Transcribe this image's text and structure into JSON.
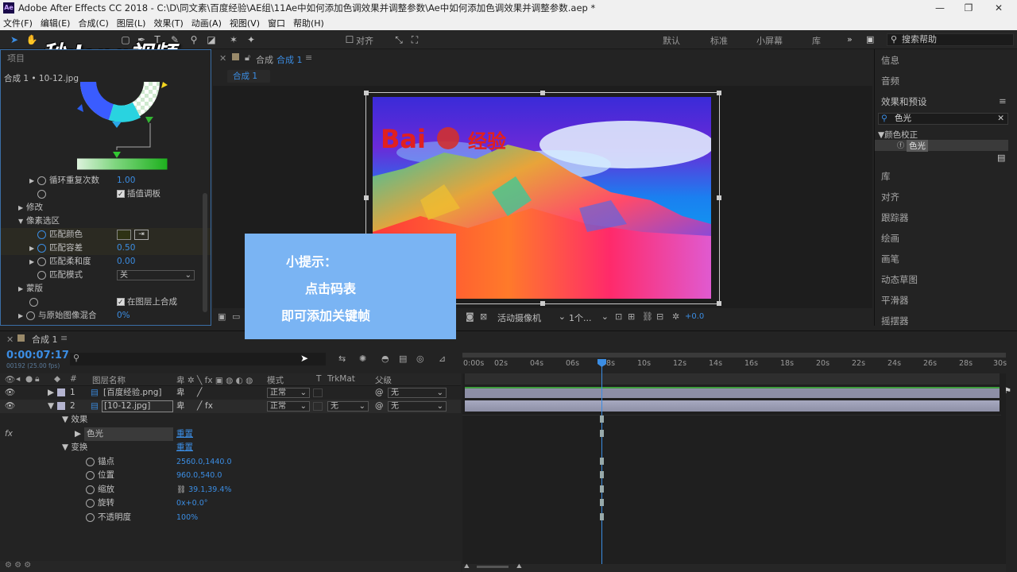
{
  "window": {
    "title": "Adobe After Effects CC 2018 - C:\\D\\同文素\\百度经验\\AE组\\11Ae中如何添加色调效果并调整参数\\Ae中如何添加色调效果并调整参数.aep *"
  },
  "menu": [
    "文件(F)",
    "编辑(E)",
    "合成(C)",
    "图层(L)",
    "效果(T)",
    "动画(A)",
    "视图(V)",
    "窗口",
    "帮助(H)"
  ],
  "toolbar": {
    "align_label": "对齐",
    "workspaces": [
      "默认",
      "标准",
      "小屏幕",
      "库"
    ],
    "search_help_placeholder": "搜索帮助"
  },
  "watermark": "秒dong视频",
  "left_panel": {
    "tab": "项目",
    "title": "合成 1 • 10-12.jpg",
    "rows": [
      {
        "label": "循环重复次数",
        "value": "1.00"
      },
      {
        "label": "插值调板"
      },
      {
        "label": "修改"
      },
      {
        "label": "像素选区"
      },
      {
        "label": "匹配颜色"
      },
      {
        "label": "匹配容差",
        "value": "0.50"
      },
      {
        "label": "匹配柔和度",
        "value": "0.00"
      },
      {
        "label": "匹配模式",
        "value": "关"
      },
      {
        "label": "蒙版"
      },
      {
        "label": "在图层上合成"
      },
      {
        "label": "与原始图像混合",
        "value": "0%"
      }
    ]
  },
  "composition": {
    "tab_label": "合成",
    "tab_name": "合成 1",
    "sub_tab": "合成 1",
    "image_logo": "Bai",
    "image_logo_suffix": "经验",
    "camera": "活动摄像机",
    "views": "1个...",
    "exposure": "+0.0"
  },
  "right_panel": {
    "items_top": [
      "信息",
      "音频",
      "效果和预设"
    ],
    "search_value": "色光",
    "tree_group": "颜色校正",
    "tree_item": "色光",
    "items_bottom": [
      "库",
      "对齐",
      "跟踪器",
      "绘画",
      "画笔",
      "动态草图",
      "平滑器",
      "摇摆器"
    ]
  },
  "tip": {
    "line1": "小提示：",
    "line2": "点击码表",
    "line3": "即可添加关键帧"
  },
  "timeline": {
    "tab": "合成 1",
    "timecode": "0:00:07:17",
    "fps": "00192 (25.00 fps)",
    "columns": {
      "num": "#",
      "name": "图层名称",
      "mode": "模式",
      "t": "T",
      "trkmat": "TrkMat",
      "parent": "父级"
    },
    "layers": [
      {
        "num": "1",
        "name": "[百度经验.png]",
        "mode": "正常",
        "trkmat": "",
        "parent": "无"
      },
      {
        "num": "2",
        "name": "[10-12.jpg]",
        "mode": "正常",
        "trkmat": "无",
        "parent": "无"
      }
    ],
    "effects_label": "效果",
    "effect_name": "色光",
    "reset": "重置",
    "transform_label": "变换",
    "props": [
      {
        "label": "锚点",
        "value": "2560.0,1440.0"
      },
      {
        "label": "位置",
        "value": "960.0,540.0"
      },
      {
        "label": "缩放",
        "value": "39.1,39.4%"
      },
      {
        "label": "旋转",
        "value": "0x+0.0°"
      },
      {
        "label": "不透明度",
        "value": "100%"
      }
    ],
    "ruler": [
      "0:00s",
      "02s",
      "04s",
      "06s",
      "08s",
      "10s",
      "12s",
      "14s",
      "16s",
      "18s",
      "20s",
      "22s",
      "24s",
      "26s",
      "28s",
      "30s"
    ]
  },
  "colors": {
    "accent": "#3b8de3",
    "tip_bg": "#7ab4f3",
    "layer_bar": "#8d8fa6"
  }
}
